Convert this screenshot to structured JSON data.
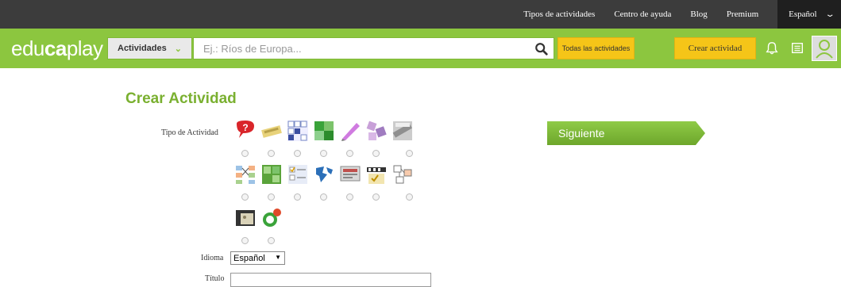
{
  "topbar": {
    "links": [
      "Tipos de actividades",
      "Centro de ayuda",
      "Blog",
      "Premium"
    ],
    "language": "Español"
  },
  "header": {
    "logo_light1": "edu",
    "logo_bold": "ca",
    "logo_light2": "play",
    "activities_label": "Actividades",
    "search_placeholder": "Ej.: Ríos de Europa...",
    "all_activities_label": "Todas las actividades",
    "create_label": "Crear actividad"
  },
  "form": {
    "title": "Crear Actividad",
    "activity_type_label": "Tipo de Actividad",
    "language_label": "Idioma",
    "language_value": "Español",
    "title_label": "Título",
    "next_label": "Siguiente"
  },
  "colors": {
    "brand_green": "#8cc63f",
    "accent_yellow": "#f5c518",
    "dark": "#3c3c3c"
  }
}
